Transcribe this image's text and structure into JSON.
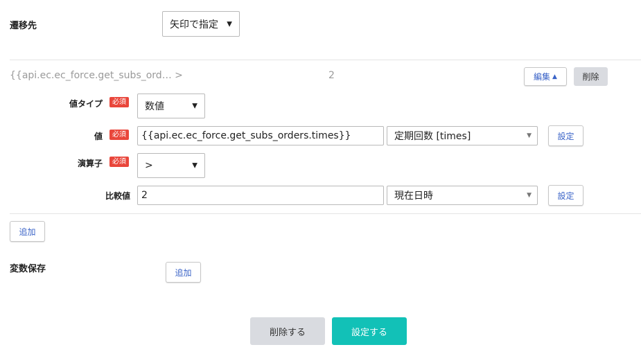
{
  "transition": {
    "label": "遷移先",
    "select_value": "矢印で指定"
  },
  "condition": {
    "summary_left": "{{api.ec.ec_force.get_subs_ord… >",
    "summary_right": "2",
    "edit_label": "編集",
    "delete_label": "削除",
    "required_badge": "必須",
    "value_type": {
      "label": "値タイプ",
      "select_value": "数値"
    },
    "value": {
      "label": "値",
      "input_value": "{{api.ec.ec_force.get_subs_orders.times}}",
      "select_value": "定期回数 [times]",
      "settings_label": "設定"
    },
    "operator": {
      "label": "演算子",
      "select_value": ">"
    },
    "compare": {
      "label": "比較値",
      "input_value": "2",
      "select_value": "現在日時",
      "settings_label": "設定"
    },
    "add_label": "追加"
  },
  "variable_save": {
    "label": "変数保存",
    "add_label": "追加"
  },
  "footer": {
    "delete_label": "削除する",
    "confirm_label": "設定する"
  },
  "colors": {
    "accent_teal": "#12c1b7",
    "badge_red": "#e9463b",
    "link_blue": "#3a63c7"
  }
}
